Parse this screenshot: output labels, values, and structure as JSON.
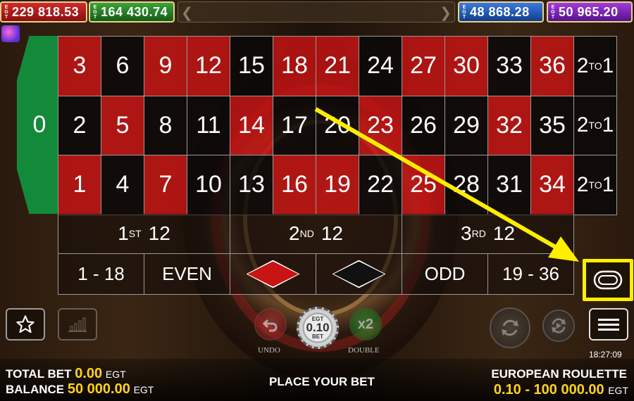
{
  "jackpots": [
    {
      "provider": "EGT",
      "value": "229 818.53",
      "color": "#c81e1e"
    },
    {
      "provider": "EGT",
      "value": "164 430.74",
      "color": "#2a8a2a"
    },
    {
      "provider": "EGT",
      "value": "48 868.28",
      "color": "#2a63c8"
    },
    {
      "provider": "EGT",
      "value": "50 965.20",
      "color": "#8a2ac8"
    }
  ],
  "table": {
    "zero": "0",
    "rows": [
      [
        "3",
        "6",
        "9",
        "12",
        "15",
        "18",
        "21",
        "24",
        "27",
        "30",
        "33",
        "36"
      ],
      [
        "2",
        "5",
        "8",
        "11",
        "14",
        "17",
        "20",
        "23",
        "26",
        "29",
        "32",
        "35"
      ],
      [
        "1",
        "4",
        "7",
        "10",
        "13",
        "16",
        "19",
        "22",
        "25",
        "28",
        "31",
        "34"
      ]
    ],
    "red_numbers": [
      "1",
      "3",
      "5",
      "7",
      "9",
      "12",
      "14",
      "16",
      "18",
      "19",
      "21",
      "23",
      "25",
      "27",
      "30",
      "32",
      "34",
      "36"
    ],
    "column_bet": {
      "prefix": "2",
      "sup": "TO",
      "suffix": "1"
    },
    "dozens": [
      {
        "ord": "1",
        "sup": "ST",
        "num": "12"
      },
      {
        "ord": "2",
        "sup": "ND",
        "num": "12"
      },
      {
        "ord": "3",
        "sup": "RD",
        "num": "12"
      }
    ],
    "outside": {
      "low": "1 - 18",
      "even": "EVEN",
      "odd": "ODD",
      "high": "19 - 36"
    }
  },
  "controls": {
    "undo_label": "UNDO",
    "double_label": "DOUBLE",
    "double_icon": "x2",
    "chip": {
      "brand": "EGT",
      "value": "0.10",
      "unit": "BET"
    }
  },
  "clock": "18:27:09",
  "footer": {
    "total_bet_label": "TOTAL BET",
    "total_bet_value": "0.00",
    "balance_label": "BALANCE",
    "balance_value": "50 000.00",
    "currency": "EGT",
    "status": "PLACE YOUR BET",
    "game_title": "EUROPEAN ROULETTE",
    "limits": "0.10 - 100 000.00"
  },
  "colors": {
    "red": "#c81414",
    "black": "#0a0808",
    "green": "#138a3a",
    "highlight": "#ffee00",
    "gold": "#ffd21e"
  },
  "icons": [
    "star-icon",
    "bar-chart-icon",
    "undo-icon",
    "rebet-icon",
    "autoplay-icon",
    "menu-icon",
    "racetrack-icon"
  ]
}
